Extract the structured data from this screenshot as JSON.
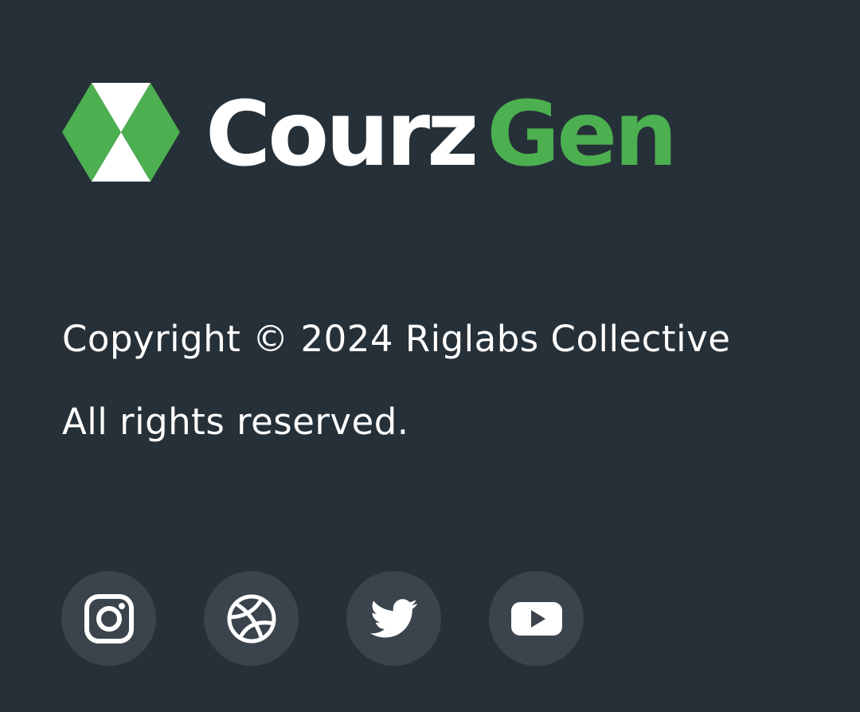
{
  "brand": {
    "name_part_1": "Courz",
    "name_part_2": "Gen",
    "logo_icon": "hexagon-triangles-logo",
    "colors": {
      "text": "#ffffff",
      "accent": "#4caf50",
      "background": "#263038",
      "social_button_bg": "#3b444d"
    }
  },
  "footer": {
    "copyright": "Copyright © 2024 Riglabs Collective",
    "rights": "All rights reserved."
  },
  "socials": [
    {
      "icon": "instagram-icon"
    },
    {
      "icon": "dribbble-icon"
    },
    {
      "icon": "twitter-icon"
    },
    {
      "icon": "youtube-icon"
    }
  ]
}
